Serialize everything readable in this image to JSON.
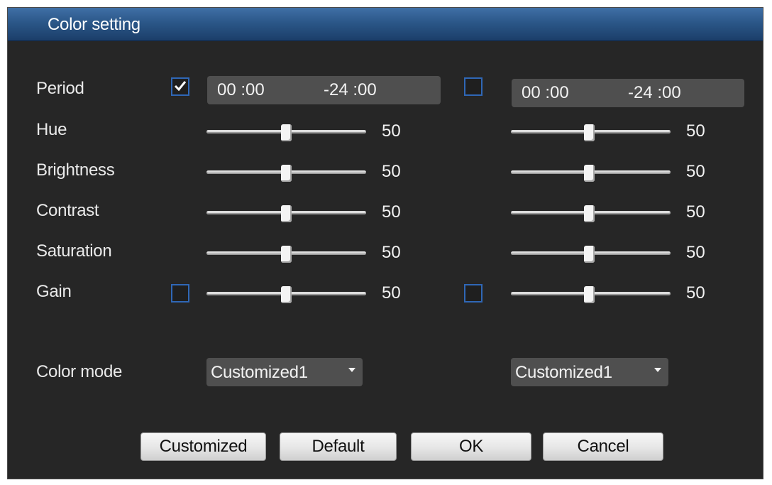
{
  "dialog": {
    "title": "Color setting"
  },
  "labels": {
    "period": "Period",
    "hue": "Hue",
    "brightness": "Brightness",
    "contrast": "Contrast",
    "saturation": "Saturation",
    "gain": "Gain",
    "color_mode": "Color mode"
  },
  "period1": {
    "checked": true,
    "start": "00 :00",
    "end": "-24 :00"
  },
  "period2": {
    "checked": false,
    "start": "00 :00",
    "end": "-24 :00"
  },
  "col1": {
    "hue": "50",
    "brightness": "50",
    "contrast": "50",
    "saturation": "50",
    "gain": "50",
    "gain_checked": false,
    "color_mode": "Customized1"
  },
  "col2": {
    "hue": "50",
    "brightness": "50",
    "contrast": "50",
    "saturation": "50",
    "gain": "50",
    "gain_checked": false,
    "color_mode": "Customized1"
  },
  "buttons": {
    "customized": "Customized",
    "default": "Default",
    "ok": "OK",
    "cancel": "Cancel"
  },
  "colors": {
    "title_bar": "#2b5788",
    "background": "#262626",
    "checkbox_border": "#2f67b6"
  },
  "icons": {
    "checked": "check-icon",
    "dropdown": "chevron-down-icon"
  }
}
